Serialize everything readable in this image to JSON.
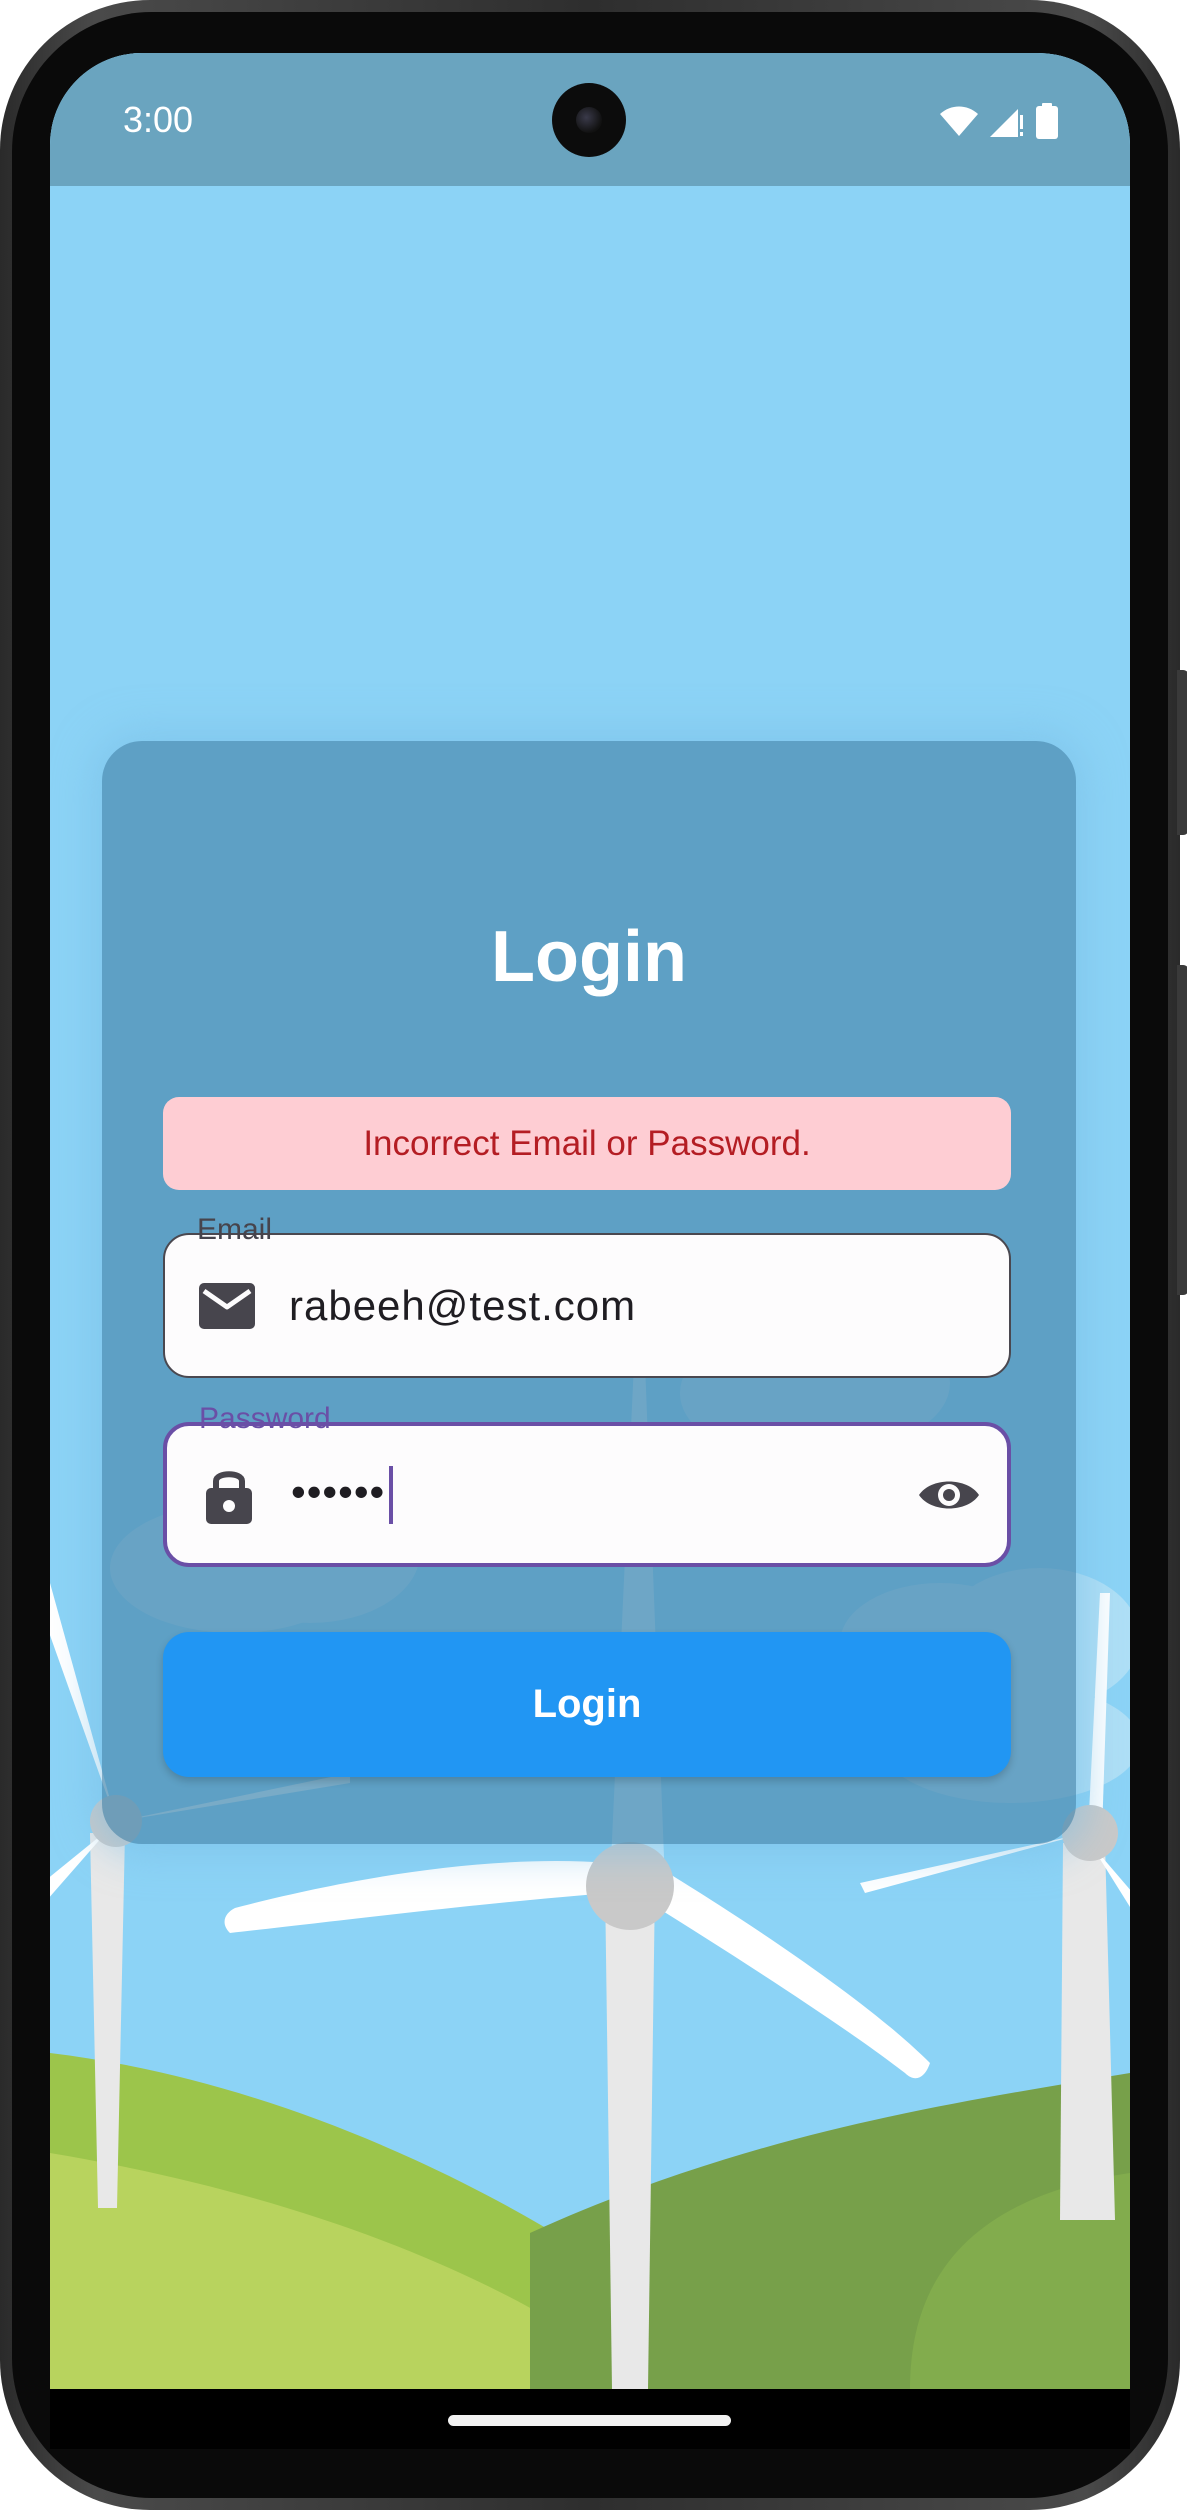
{
  "status_bar": {
    "time": "3:00",
    "icons": [
      "wifi-icon",
      "cell-signal-icon",
      "battery-icon"
    ]
  },
  "login": {
    "title": "Login",
    "error_message": "Incorrect Email or Password.",
    "email": {
      "label": "Email",
      "value": "rabeeh@test.com",
      "icon": "mail-icon"
    },
    "password": {
      "label": "Password",
      "value": "••••••",
      "icon": "lock-icon",
      "toggle_icon": "eye-icon"
    },
    "submit_label": "Login"
  },
  "colors": {
    "sky": "#8cd3f6",
    "status_bar": "#6aa4bf",
    "card": "#4c8cb2",
    "error_bg": "#fecdd3",
    "error_text": "#b41d23",
    "focus": "#6a4fa6",
    "button": "#2196f3"
  }
}
